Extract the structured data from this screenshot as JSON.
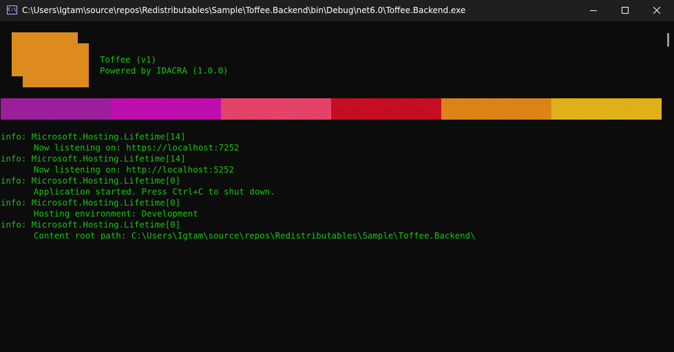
{
  "window": {
    "title": "C:\\Users\\Igtam\\source\\repos\\Redistributables\\Sample\\Toffee.Backend\\bin\\Debug\\net6.0\\Toffee.Backend.exe",
    "icon_text": "C:\\"
  },
  "banner": {
    "line1": "Toffee (v1)",
    "line2": "Powered by IDACRA (1.0.0)",
    "logo_color": "#dd8a1f"
  },
  "color_bar": [
    {
      "color": "#9e1f9e"
    },
    {
      "color": "#c00fb0"
    },
    {
      "color": "#e8446b"
    },
    {
      "color": "#c80f23"
    },
    {
      "color": "#e0861a"
    },
    {
      "color": "#e4b41d"
    }
  ],
  "log": [
    {
      "category": "info: Microsoft.Hosting.Lifetime[14]",
      "message": "Now listening on: https://localhost:7252"
    },
    {
      "category": "info: Microsoft.Hosting.Lifetime[14]",
      "message": "Now listening on: http://localhost:5252"
    },
    {
      "category": "info: Microsoft.Hosting.Lifetime[0]",
      "message": "Application started. Press Ctrl+C to shut down."
    },
    {
      "category": "info: Microsoft.Hosting.Lifetime[0]",
      "message": "Hosting environment: Development"
    },
    {
      "category": "info: Microsoft.Hosting.Lifetime[0]",
      "message": "Content root path: C:\\Users\\Igtam\\source\\repos\\Redistributables\\Sample\\Toffee.Backend\\"
    }
  ],
  "colors": {
    "text": "#16c60c",
    "background": "#0c0c0c",
    "titlebar": "#1f1f1f"
  }
}
